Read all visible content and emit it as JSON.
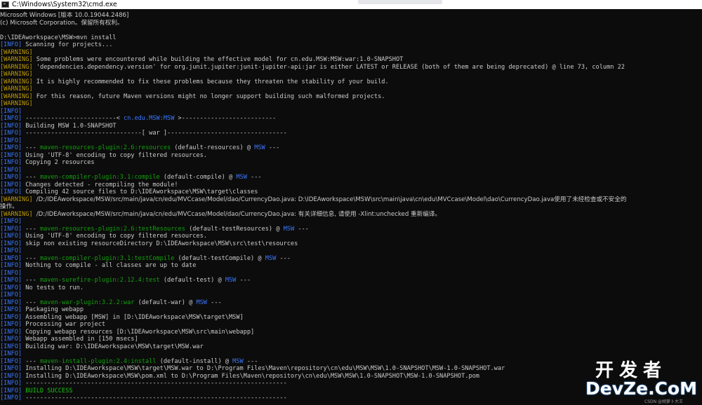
{
  "window": {
    "title": "C:\\Windows\\System32\\cmd.exe",
    "icon": "cmd-icon"
  },
  "console": {
    "lines": [
      {
        "text": "Microsoft Windows [版本 10.0.19044.2486]"
      },
      {
        "text": "(c) Microsoft Corporation。保留所有权利。"
      },
      {
        "text": ""
      },
      {
        "text": "D:\\IDEAworkspace\\MSW>mvn install"
      },
      {
        "tag": "INFO",
        "text": "Scanning for projects..."
      },
      {
        "tag": "WARNING",
        "text": ""
      },
      {
        "tag": "WARNING",
        "text": "Some problems were encountered while building the effective model for cn.edu.MSW:MSW:war:1.0-SNAPSHOT"
      },
      {
        "tag": "WARNING",
        "text": "'dependencies.dependency.version' for org.junit.jupiter:junit-jupiter-api:jar is either LATEST or RELEASE (both of them are being deprecated) @ line 73, column 22"
      },
      {
        "tag": "WARNING",
        "text": ""
      },
      {
        "tag": "WARNING",
        "text": "It is highly recommended to fix these problems because they threaten the stability of your build."
      },
      {
        "tag": "WARNING",
        "text": ""
      },
      {
        "tag": "WARNING",
        "text": "For this reason, future Maven versions might no longer support building such malformed projects."
      },
      {
        "tag": "WARNING",
        "text": ""
      },
      {
        "tag": "INFO",
        "text": ""
      },
      {
        "tag": "INFO",
        "text": "-------------------------< ",
        "proj": "cn.edu.MSW:MSW",
        "after": " >--------------------------"
      },
      {
        "tag": "INFO",
        "text": "Building MSW 1.0-SNAPSHOT"
      },
      {
        "tag": "INFO",
        "text": "--------------------------------[ war ]---------------------------------"
      },
      {
        "tag": "INFO",
        "text": ""
      },
      {
        "tag": "INFO",
        "text": "--- ",
        "plugin": "maven-resources-plugin:2.6:resources",
        "after": " (default-resources) @ ",
        "proj": "MSW",
        "tail": " ---"
      },
      {
        "tag": "INFO",
        "text": "Using 'UTF-8' encoding to copy filtered resources."
      },
      {
        "tag": "INFO",
        "text": "Copying 2 resources"
      },
      {
        "tag": "INFO",
        "text": ""
      },
      {
        "tag": "INFO",
        "text": "--- ",
        "plugin": "maven-compiler-plugin:3.1:compile",
        "after": " (default-compile) @ ",
        "proj": "MSW",
        "tail": " ---"
      },
      {
        "tag": "INFO",
        "text": "Changes detected - recompiling the module!"
      },
      {
        "tag": "INFO",
        "text": "Compiling 42 source files to D:\\IDEAworkspace\\MSW\\target\\classes"
      },
      {
        "tag": "WARNING",
        "text": "/D:/IDEAworkspace/MSW/src/main/java/cn/edu/MVCcase/Model/dao/CurrencyDao.java: D:\\IDEAworkspace\\MSW\\src\\main\\java\\cn\\edu\\MVCcase\\Model\\dao\\CurrencyDao.java使用了未经检查或不安全的"
      },
      {
        "text": "操作。"
      },
      {
        "tag": "WARNING",
        "text": "/D:/IDEAworkspace/MSW/src/main/java/cn/edu/MVCcase/Model/dao/CurrencyDao.java: 有关详细信息, 请使用 -Xlint:unchecked 重新编译。"
      },
      {
        "tag": "INFO",
        "text": ""
      },
      {
        "tag": "INFO",
        "text": "--- ",
        "plugin": "maven-resources-plugin:2.6:testResources",
        "after": " (default-testResources) @ ",
        "proj": "MSW",
        "tail": " ---"
      },
      {
        "tag": "INFO",
        "text": "Using 'UTF-8' encoding to copy filtered resources."
      },
      {
        "tag": "INFO",
        "text": "skip non existing resourceDirectory D:\\IDEAworkspace\\MSW\\src\\test\\resources"
      },
      {
        "tag": "INFO",
        "text": ""
      },
      {
        "tag": "INFO",
        "text": "--- ",
        "plugin": "maven-compiler-plugin:3.1:testCompile",
        "after": " (default-testCompile) @ ",
        "proj": "MSW",
        "tail": " ---"
      },
      {
        "tag": "INFO",
        "text": "Nothing to compile - all classes are up to date"
      },
      {
        "tag": "INFO",
        "text": ""
      },
      {
        "tag": "INFO",
        "text": "--- ",
        "plugin": "maven-surefire-plugin:2.12.4:test",
        "after": " (default-test) @ ",
        "proj": "MSW",
        "tail": " ---"
      },
      {
        "tag": "INFO",
        "text": "No tests to run."
      },
      {
        "tag": "INFO",
        "text": ""
      },
      {
        "tag": "INFO",
        "text": "--- ",
        "plugin": "maven-war-plugin:3.2.2:war",
        "after": " (default-war) @ ",
        "proj": "MSW",
        "tail": " ---"
      },
      {
        "tag": "INFO",
        "text": "Packaging webapp"
      },
      {
        "tag": "INFO",
        "text": "Assembling webapp [MSW] in [D:\\IDEAworkspace\\MSW\\target\\MSW]"
      },
      {
        "tag": "INFO",
        "text": "Processing war project"
      },
      {
        "tag": "INFO",
        "text": "Copying webapp resources [D:\\IDEAworkspace\\MSW\\src\\main\\webapp]"
      },
      {
        "tag": "INFO",
        "text": "Webapp assembled in [150 msecs]"
      },
      {
        "tag": "INFO",
        "text": "Building war: D:\\IDEAworkspace\\MSW\\target\\MSW.war"
      },
      {
        "tag": "INFO",
        "text": ""
      },
      {
        "tag": "INFO",
        "text": "--- ",
        "plugin": "maven-install-plugin:2.4:install",
        "after": " (default-install) @ ",
        "proj": "MSW",
        "tail": " ---"
      },
      {
        "tag": "INFO",
        "text": "Installing D:\\IDEAworkspace\\MSW\\target\\MSW.war to D:\\Program Files\\Maven\\repository\\cn\\edu\\MSW\\MSW\\1.0-SNAPSHOT\\MSW-1.0-SNAPSHOT.war"
      },
      {
        "tag": "INFO",
        "text": "Installing D:\\IDEAworkspace\\MSW\\pom.xml to D:\\Program Files\\Maven\\repository\\cn\\edu\\MSW\\MSW\\1.0-SNAPSHOT\\MSW-1.0-SNAPSHOT.pom"
      },
      {
        "tag": "INFO",
        "text": "------------------------------------------------------------------------"
      },
      {
        "tag": "INFO",
        "text": "BUILD SUCCESS",
        "success": true
      },
      {
        "tag": "INFO",
        "text": "------------------------------------------------------------------------"
      }
    ]
  },
  "watermark": {
    "brand_cn": "开发者",
    "brand_en": "DevZe.CoM",
    "small": "CSDN @胡萝卜大王"
  }
}
